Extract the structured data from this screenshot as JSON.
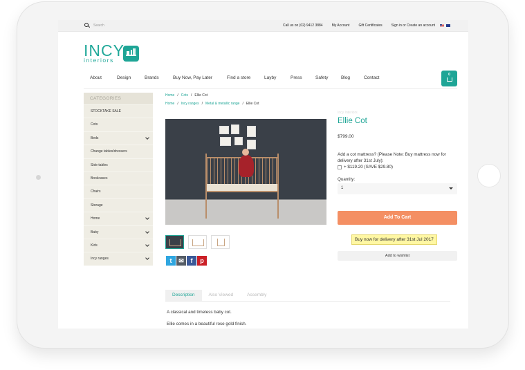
{
  "topbar": {
    "search_placeholder": "Search",
    "links": [
      "Call us on (02) 9412 3884",
      "My Account",
      "Gift Certificates",
      "Sign in or Create an account"
    ]
  },
  "logo": {
    "word": "INCY",
    "sub": "interiors"
  },
  "nav": [
    "About",
    "Design",
    "Brands",
    "Buy Now, Pay Later",
    "Find a store",
    "Layby",
    "Press",
    "Safety",
    "Blog",
    "Contact"
  ],
  "cart": {
    "count": "0"
  },
  "sidebar": {
    "heading": "CATEGORIES",
    "items": [
      {
        "label": "STOCKTAKE SALE",
        "has_children": false
      },
      {
        "label": "Cots",
        "has_children": false
      },
      {
        "label": "Beds",
        "has_children": true
      },
      {
        "label": "Change tables/dressers",
        "has_children": false
      },
      {
        "label": "Side tables",
        "has_children": false
      },
      {
        "label": "Bookcases",
        "has_children": false
      },
      {
        "label": "Chairs",
        "has_children": false
      },
      {
        "label": "Storage",
        "has_children": false
      },
      {
        "label": "Home",
        "has_children": true
      },
      {
        "label": "Baby",
        "has_children": true
      },
      {
        "label": "Kids",
        "has_children": true
      },
      {
        "label": "Incy ranges",
        "has_children": true
      }
    ]
  },
  "breadcrumbs": {
    "line1": {
      "home": "Home",
      "cat": "Cots",
      "current": "Ellie Cot"
    },
    "line2": {
      "home": "Home",
      "range": "Incy ranges",
      "sub": "Metal & metallic range",
      "current": "Ellie Cot"
    }
  },
  "product": {
    "brand_faint": "Incy Interiors",
    "title": "Ellie Cot",
    "price": "$799.00",
    "addon_question": "Add a cot mattress? (Please Note: Buy mattress now for delivery after 31st July):",
    "addon_option": "+ $119.20 (SAVE $29.80)",
    "quantity_label": "Quantity:",
    "quantity_value": "1",
    "add_to_cart": "Add To Cart",
    "promo": "Buy now for delivery after 31st Jul 2017",
    "wishlist": "Add to wishlist"
  },
  "tabs": [
    "Description",
    "Also Viewed",
    "Assembly"
  ],
  "description": [
    "A classical and timeless baby cot.",
    "Ellie comes in a beautiful rose gold finish."
  ],
  "colors": {
    "accent": "#1ea596",
    "cta": "#f48f63",
    "promo_bg": "#fff7a3"
  }
}
